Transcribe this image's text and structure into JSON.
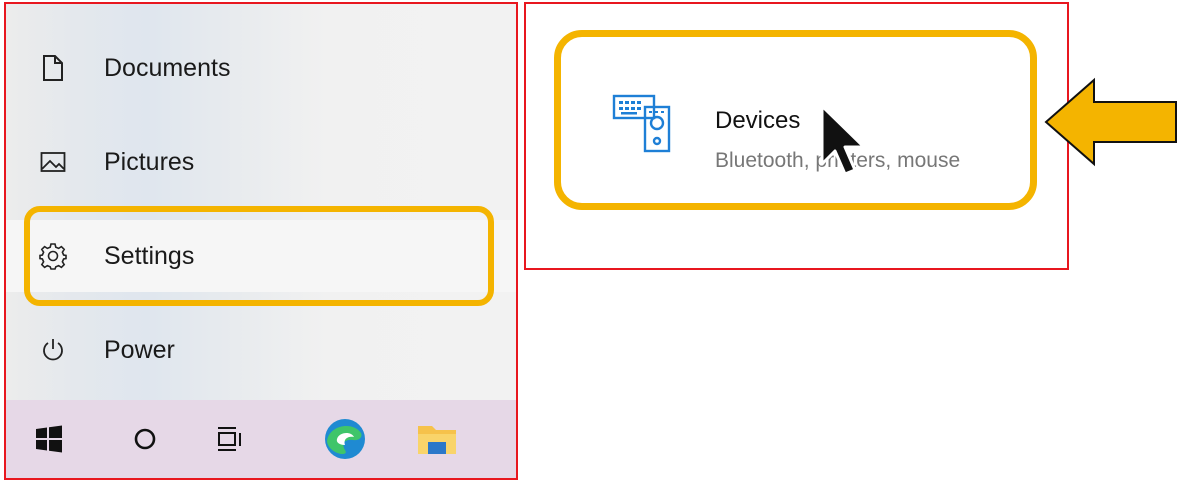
{
  "start_menu": {
    "items": [
      {
        "label": "Documents",
        "icon": "document-icon"
      },
      {
        "label": "Pictures",
        "icon": "pictures-icon"
      },
      {
        "label": "Settings",
        "icon": "gear-icon",
        "highlighted": true
      },
      {
        "label": "Power",
        "icon": "power-icon"
      }
    ]
  },
  "taskbar": {
    "buttons": [
      {
        "icon": "windows-start-icon"
      },
      {
        "icon": "search-circle-icon"
      },
      {
        "icon": "task-view-icon"
      },
      {
        "icon": "edge-browser-icon"
      },
      {
        "icon": "file-explorer-icon"
      }
    ]
  },
  "settings_tile": {
    "title": "Devices",
    "description": "Bluetooth, printers, mouse",
    "icon": "devices-icon",
    "highlighted": true
  },
  "colors": {
    "highlight": "#f4b400",
    "frame": "#e8171f",
    "accent": "#1e7fd6",
    "taskbar": "#e6d8e7"
  },
  "annotation": {
    "arrow": "callout-arrow-icon",
    "cursor": "mouse-pointer-icon"
  }
}
